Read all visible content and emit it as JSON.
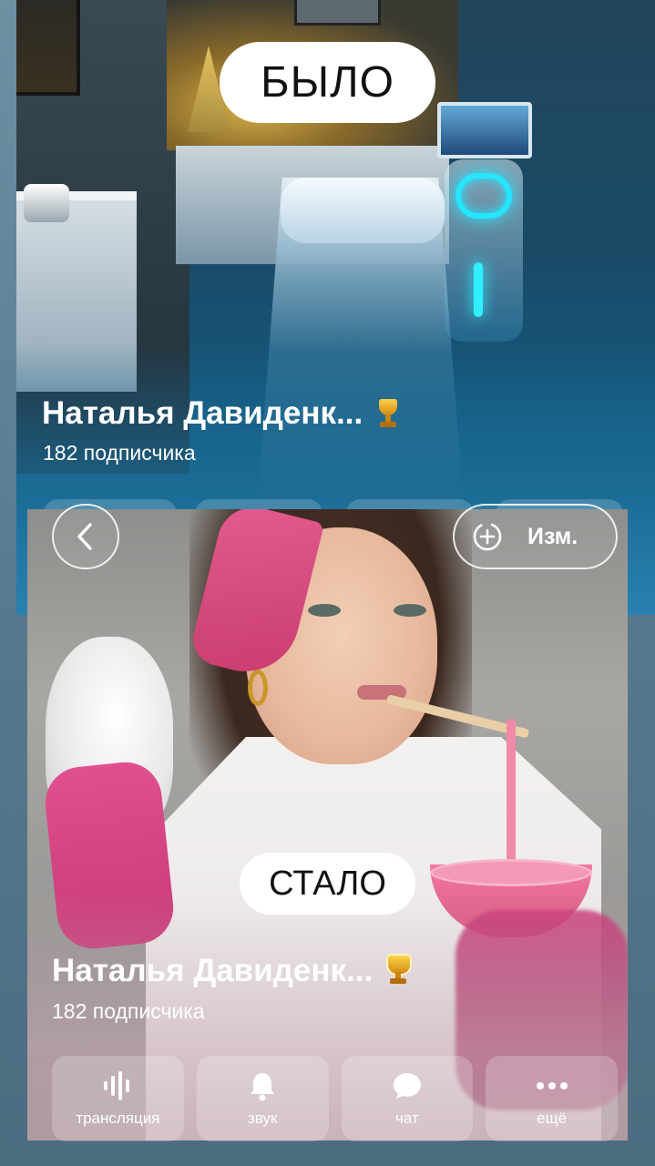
{
  "before": {
    "label": "БЫЛО",
    "profile_name": "Наталья Давиденк...",
    "subscribers": "182 подписчика",
    "trophy_icon": "trophy-icon"
  },
  "after": {
    "label": "СТАЛО",
    "profile_name": "Наталья Давиденк...",
    "subscribers": "182 подписчика",
    "trophy_icon": "trophy-icon"
  },
  "header": {
    "back_icon": "chevron-left-icon",
    "edit_icon": "add-photo-icon",
    "edit_label": "Изм."
  },
  "actions": [
    {
      "label": "трансляция",
      "icon": "broadcast-icon"
    },
    {
      "label": "звук",
      "icon": "bell-icon"
    },
    {
      "label": "чат",
      "icon": "chat-bubble-icon"
    },
    {
      "label": "ещё",
      "icon": "more-dots-icon"
    }
  ],
  "colors": {
    "accent_glow": "#25e6ff",
    "headband": "#e45b8d",
    "trophy_gold": "#ffd24a"
  }
}
